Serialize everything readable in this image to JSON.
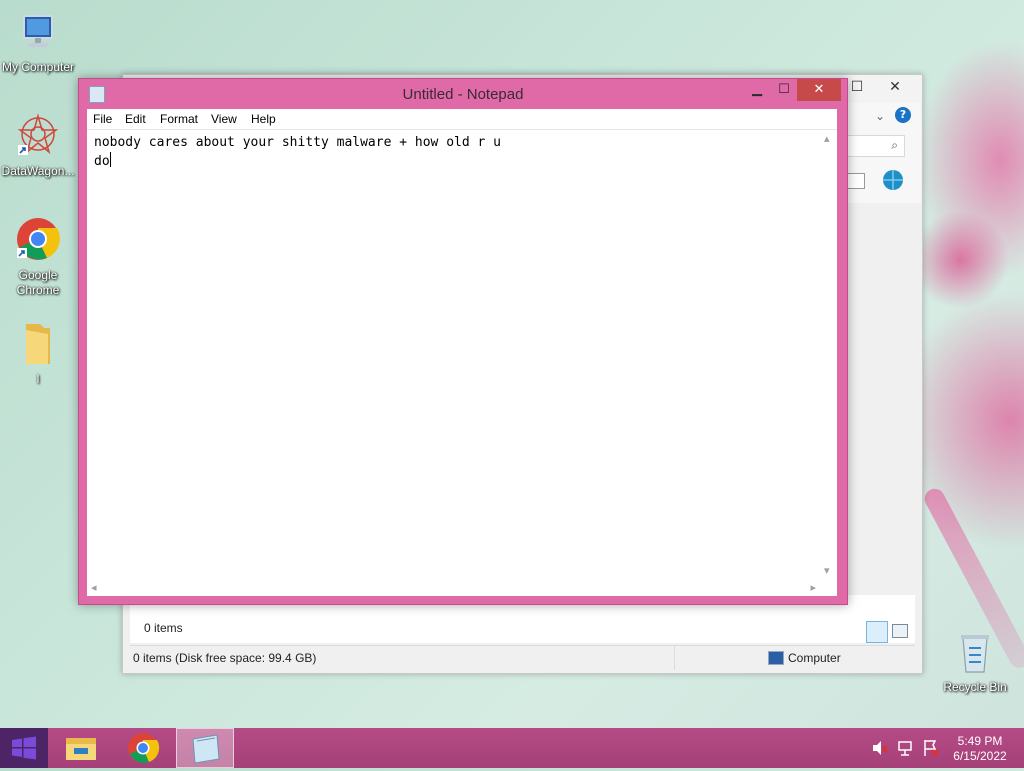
{
  "desktop": {
    "icons": [
      {
        "label": "My Computer",
        "icon": "computer-icon"
      },
      {
        "label": "DataWagon...",
        "icon": "datawagon-icon"
      },
      {
        "label": "Google Chrome",
        "icon": "chrome-icon"
      },
      {
        "label": "l",
        "icon": "folder-icon"
      },
      {
        "label": "Recycle Bin",
        "icon": "recycle-bin-icon"
      }
    ]
  },
  "explorer": {
    "items_text": "0 items",
    "status_left": "0 items (Disk free space: 99.4 GB)",
    "status_right": "Computer"
  },
  "notepad": {
    "title": "Untitled - Notepad",
    "menu": [
      "File",
      "Edit",
      "Format",
      "View",
      "Help"
    ],
    "lines": [
      "nobody cares about your shitty malware + how old r u",
      "do"
    ]
  },
  "taskbar": {
    "pinned": [
      "file-explorer-icon",
      "chrome-icon",
      "notepad-icon"
    ],
    "active": "notepad-icon",
    "time": "5:49 PM",
    "date": "6/15/2022"
  },
  "colors": {
    "notepad_frame": "#e06aa8",
    "taskbar": "#a54079",
    "close_button": "#c74a4a"
  }
}
